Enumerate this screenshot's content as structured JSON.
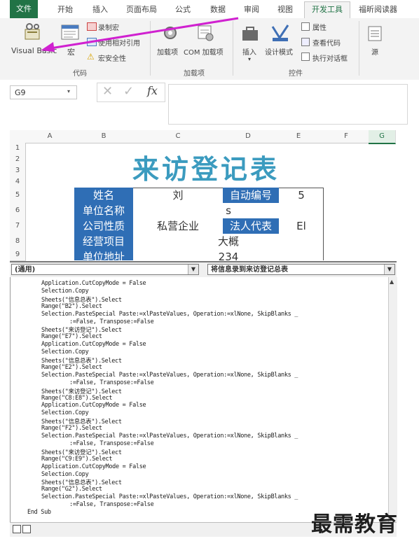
{
  "ribbon": {
    "tabs": [
      "文件",
      "开始",
      "插入",
      "页面布局",
      "公式",
      "数据",
      "审阅",
      "视图",
      "开发工具",
      "福昕阅读器"
    ],
    "code_group": {
      "visual_basic": "Visual Basic",
      "macros": "宏",
      "record_macro": "录制宏",
      "relative_refs": "使用相对引用",
      "macro_security": "宏安全性",
      "group_label": "代码"
    },
    "addins_group": {
      "addins": "加载项",
      "com_addins": "COM 加载项",
      "group_label": "加载项"
    },
    "controls_group": {
      "insert": "插入",
      "design_mode": "设计模式",
      "properties": "属性",
      "view_code": "查看代码",
      "run_dialog": "执行对话框",
      "group_label": "控件"
    },
    "source": "源"
  },
  "formula_bar": {
    "name_box": "G9",
    "fx": "fx",
    "cancel": "✕",
    "enter": "✓"
  },
  "sheet": {
    "columns": [
      "A",
      "B",
      "C",
      "D",
      "E",
      "F",
      "G"
    ],
    "rows": [
      "1",
      "2",
      "3",
      "4",
      "5",
      "6",
      "7",
      "8",
      "9"
    ],
    "title": "来访登记表",
    "cells": {
      "r5_b": "姓名",
      "r5_c": "刘",
      "r5_d": "自动编号",
      "r5_e": "5",
      "r6_b": "单位名称",
      "r6_cd": "s",
      "r7_b": "公司性质",
      "r7_c": "私营企业",
      "r7_d": "法人代表",
      "r7_e": "El",
      "r8_b": "经营项目",
      "r8_cd": "大概",
      "r9_b": "单位地址",
      "r9_cd": "234"
    }
  },
  "vbe": {
    "object_combo": "(通用)",
    "procedure_combo": "将信息录到来访登记总表",
    "code_lines": [
      {
        "t": "Application.CutCopyMode = False",
        "k": ""
      },
      {
        "t": "Selection.Copy",
        "k": ""
      },
      {
        "t": "Sheets(\"信息总表\").Select",
        "k": ""
      },
      {
        "t": "Range(\"B2\").Select",
        "k": ""
      },
      {
        "t": "Selection.PasteSpecial Paste:=xlPasteValues, Operation:=xlNone, SkipBlanks _",
        "k": ""
      },
      {
        "t": ":=False, Transpose:=False",
        "k": "ind"
      },
      {
        "t": "Sheets(\"来访登记\").Select",
        "k": ""
      },
      {
        "t": "Range(\"E7\").Select",
        "k": ""
      },
      {
        "t": "Application.CutCopyMode = False",
        "k": ""
      },
      {
        "t": "Selection.Copy",
        "k": ""
      },
      {
        "t": "Sheets(\"信息总表\").Select",
        "k": ""
      },
      {
        "t": "Range(\"E2\").Select",
        "k": ""
      },
      {
        "t": "Selection.PasteSpecial Paste:=xlPasteValues, Operation:=xlNone, SkipBlanks _",
        "k": ""
      },
      {
        "t": ":=False, Transpose:=False",
        "k": "ind"
      },
      {
        "t": "Sheets(\"来访登记\").Select",
        "k": ""
      },
      {
        "t": "Range(\"C8:E8\").Select",
        "k": ""
      },
      {
        "t": "Application.CutCopyMode = False",
        "k": ""
      },
      {
        "t": "Selection.Copy",
        "k": ""
      },
      {
        "t": "Sheets(\"信息总表\").Select",
        "k": ""
      },
      {
        "t": "Range(\"F2\").Select",
        "k": ""
      },
      {
        "t": "Selection.PasteSpecial Paste:=xlPasteValues, Operation:=xlNone, SkipBlanks _",
        "k": ""
      },
      {
        "t": ":=False, Transpose:=False",
        "k": "ind"
      },
      {
        "t": "Sheets(\"来访登记\").Select",
        "k": ""
      },
      {
        "t": "Range(\"C9:E9\").Select",
        "k": ""
      },
      {
        "t": "Application.CutCopyMode = False",
        "k": ""
      },
      {
        "t": "Selection.Copy",
        "k": ""
      },
      {
        "t": "Sheets(\"信息总表\").Select",
        "k": ""
      },
      {
        "t": "Range(\"G2\").Select",
        "k": ""
      },
      {
        "t": "Selection.PasteSpecial Paste:=xlPasteValues, Operation:=xlNone, SkipBlanks _",
        "k": ""
      },
      {
        "t": ":=False, Transpose:=False",
        "k": "ind"
      },
      {
        "t": "End Sub",
        "k": "end"
      }
    ]
  },
  "watermark": "最需教育",
  "colors": {
    "excel_green": "#217346",
    "header_blue": "#2f6eb5",
    "title_teal": "#3b9bbf",
    "arrow": "#d021d0"
  }
}
